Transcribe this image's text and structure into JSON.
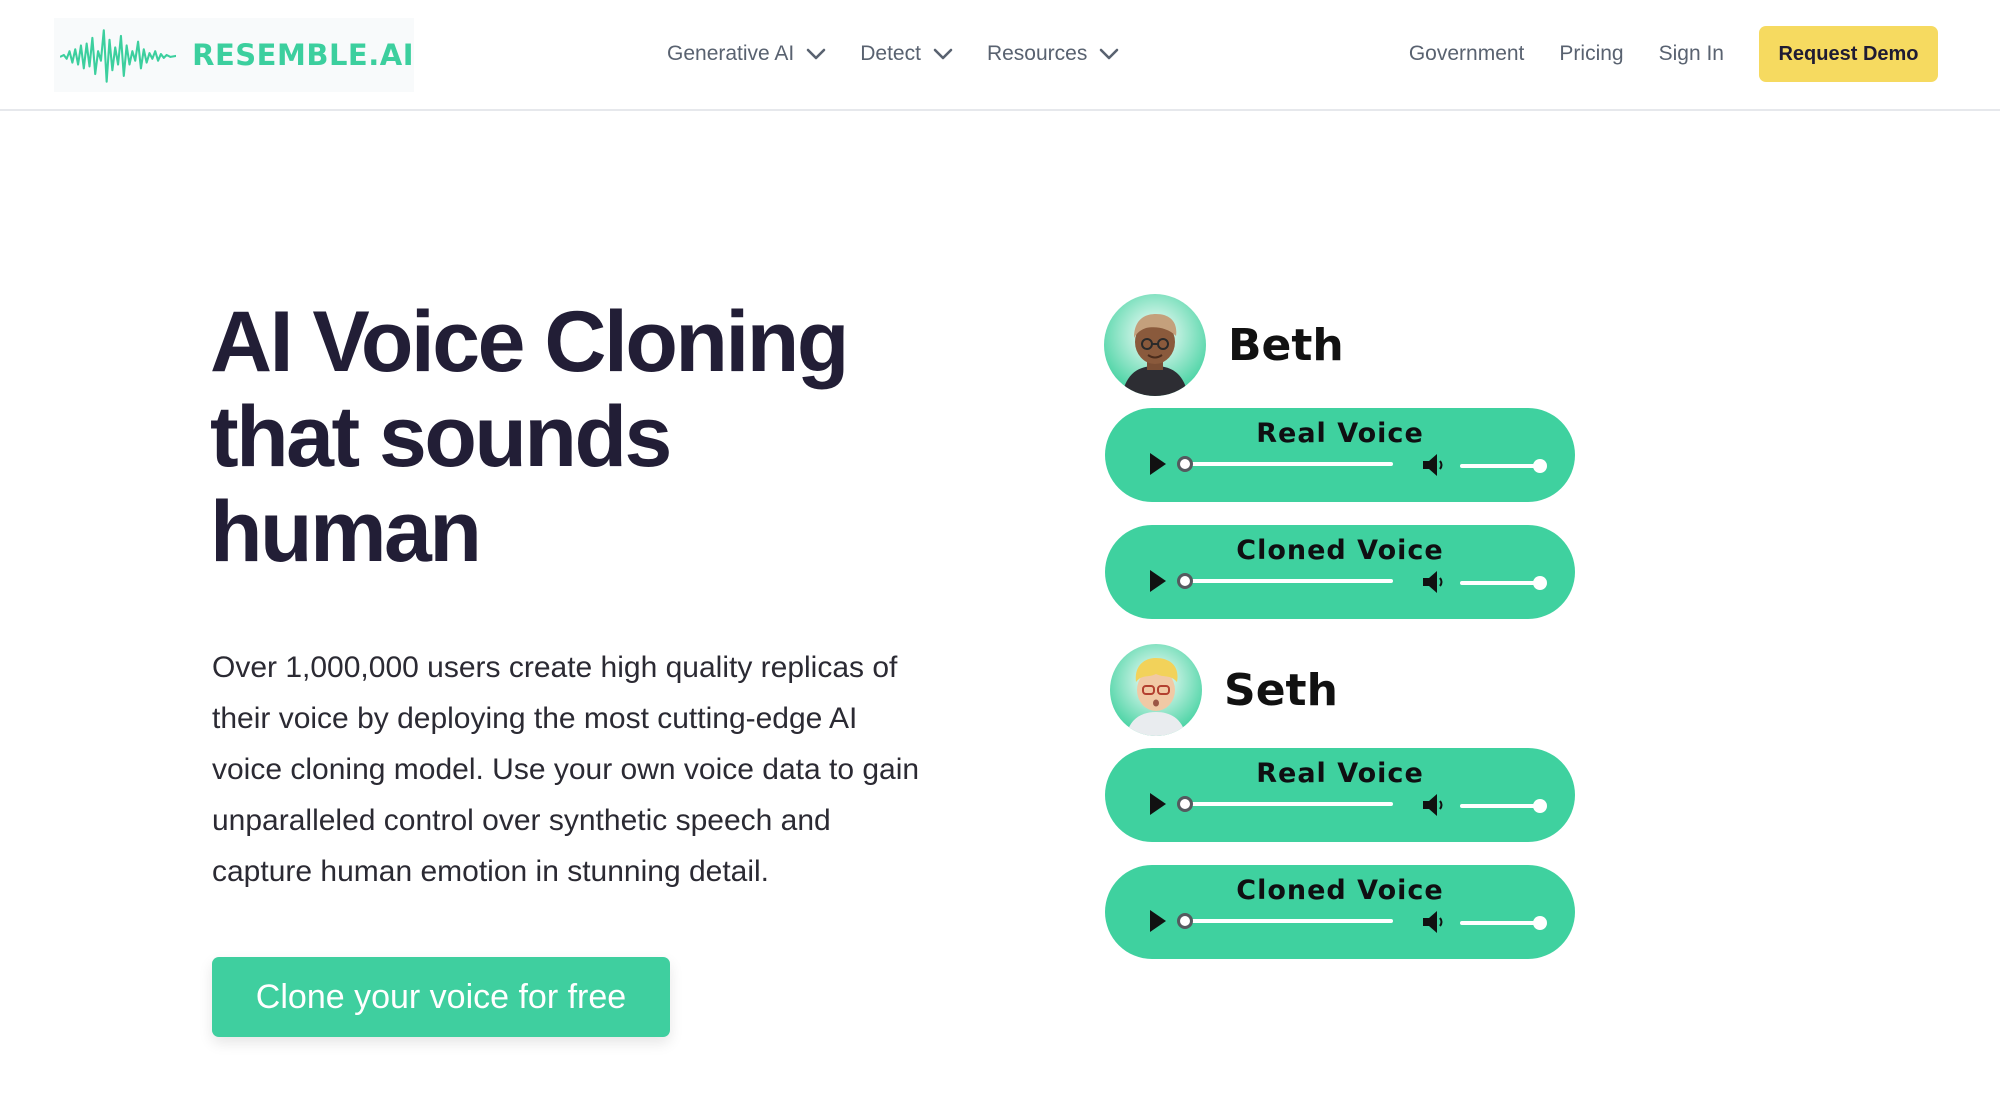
{
  "header": {
    "logo_text": "RESEMBLE.AI",
    "nav": [
      {
        "label": "Generative AI"
      },
      {
        "label": "Detect"
      },
      {
        "label": "Resources"
      }
    ],
    "links": [
      {
        "label": "Government"
      },
      {
        "label": "Pricing"
      },
      {
        "label": "Sign In"
      }
    ],
    "cta_label": "Request Demo"
  },
  "hero": {
    "title_lines": [
      "AI Voice Cloning",
      "that sounds",
      "human"
    ],
    "description_lines": [
      "Over 1,000,000 users create high quality replicas of",
      "their voice by deploying the most cutting-edge AI",
      "voice cloning model. Use your own voice data to gain",
      "unparalleled control over synthetic speech  and",
      "capture human emotion in stunning detail."
    ],
    "cta_label": "Clone your voice for free"
  },
  "voices": [
    {
      "name": "Beth",
      "players": [
        {
          "label": "Real Voice"
        },
        {
          "label": "Cloned Voice"
        }
      ]
    },
    {
      "name": "Seth",
      "players": [
        {
          "label": "Real Voice"
        },
        {
          "label": "Cloned Voice"
        }
      ]
    }
  ],
  "player_state": {
    "progress_fraction": 0,
    "volume_fraction": 1
  },
  "colors": {
    "brand_green": "#3ccf9e",
    "player_green": "#3fd19f",
    "demo_yellow": "#f6da60",
    "heading_dark": "#221e36",
    "nav_gray": "#596270"
  },
  "icons": {
    "logo": "waveform-icon",
    "nav_chevron": "chevron-down-icon",
    "play": "play-icon",
    "volume": "speaker-icon"
  }
}
